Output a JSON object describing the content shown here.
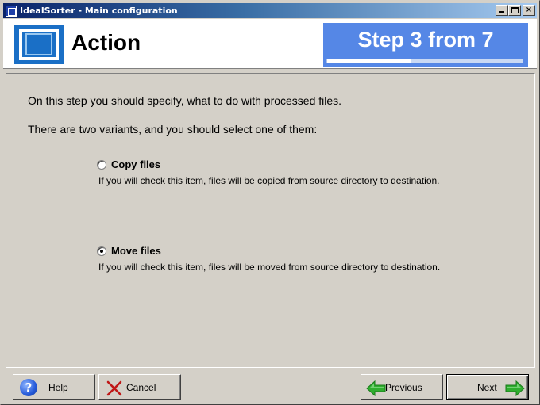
{
  "window": {
    "title": "IdealSorter - Main configuration",
    "controls": {
      "minimize": "minimize",
      "maximize": "maximize",
      "close": "×"
    }
  },
  "header": {
    "title": "Action",
    "step_label": "Step 3 from 7",
    "step_progress_fraction": 0.43
  },
  "content": {
    "intro": "On this step you should specify, what to do with processed files.",
    "prompt": "There are two variants, and you should select one of them:",
    "options": [
      {
        "label": "Copy files",
        "description": "If you will check this item, files will be copied from source directory to destination.",
        "checked": false
      },
      {
        "label": "Move files",
        "description": "If you will check this item, files will be moved from source directory to destination.",
        "checked": true
      }
    ]
  },
  "buttons": {
    "help": "Help",
    "cancel": "Cancel",
    "previous": "Previous",
    "next": "Next"
  },
  "colors": {
    "accent": "#5587e6",
    "logo": "#1a6fc6",
    "arrow_green": "#2fae2f",
    "cancel_red": "#c01818"
  },
  "icons": {
    "app": "app-icon",
    "logo": "logo-icon",
    "help": "help-icon",
    "cancel": "cancel-x-icon",
    "previous": "arrow-left-icon",
    "next": "arrow-right-icon"
  }
}
